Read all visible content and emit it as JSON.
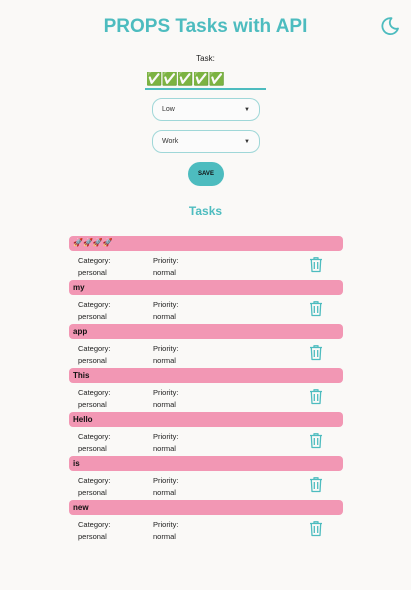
{
  "header": {
    "title": "PROPS Tasks with API"
  },
  "form": {
    "task_label": "Task:",
    "task_value": "✅✅✅✅✅",
    "priority_selected": "Low",
    "category_selected": "Work",
    "save_label": "SAVE"
  },
  "tasks_heading": "Tasks",
  "labels": {
    "category": "Category:",
    "priority": "Priority:"
  },
  "tasks": [
    {
      "title": "🚀🚀🚀🚀",
      "category": "personal",
      "priority": "normal"
    },
    {
      "title": "my",
      "category": "personal",
      "priority": "normal"
    },
    {
      "title": "app",
      "category": "personal",
      "priority": "normal"
    },
    {
      "title": "This",
      "category": "personal",
      "priority": "normal"
    },
    {
      "title": "Hello",
      "category": "personal",
      "priority": "normal"
    },
    {
      "title": "is",
      "category": "personal",
      "priority": "normal"
    },
    {
      "title": "new",
      "category": "personal",
      "priority": "normal"
    }
  ],
  "colors": {
    "accent": "#4dbcbf",
    "task_bar": "#f297b4",
    "trash": "#4dbcbf"
  },
  "icons": {
    "theme_toggle": "moon-icon",
    "delete": "trash-icon"
  }
}
